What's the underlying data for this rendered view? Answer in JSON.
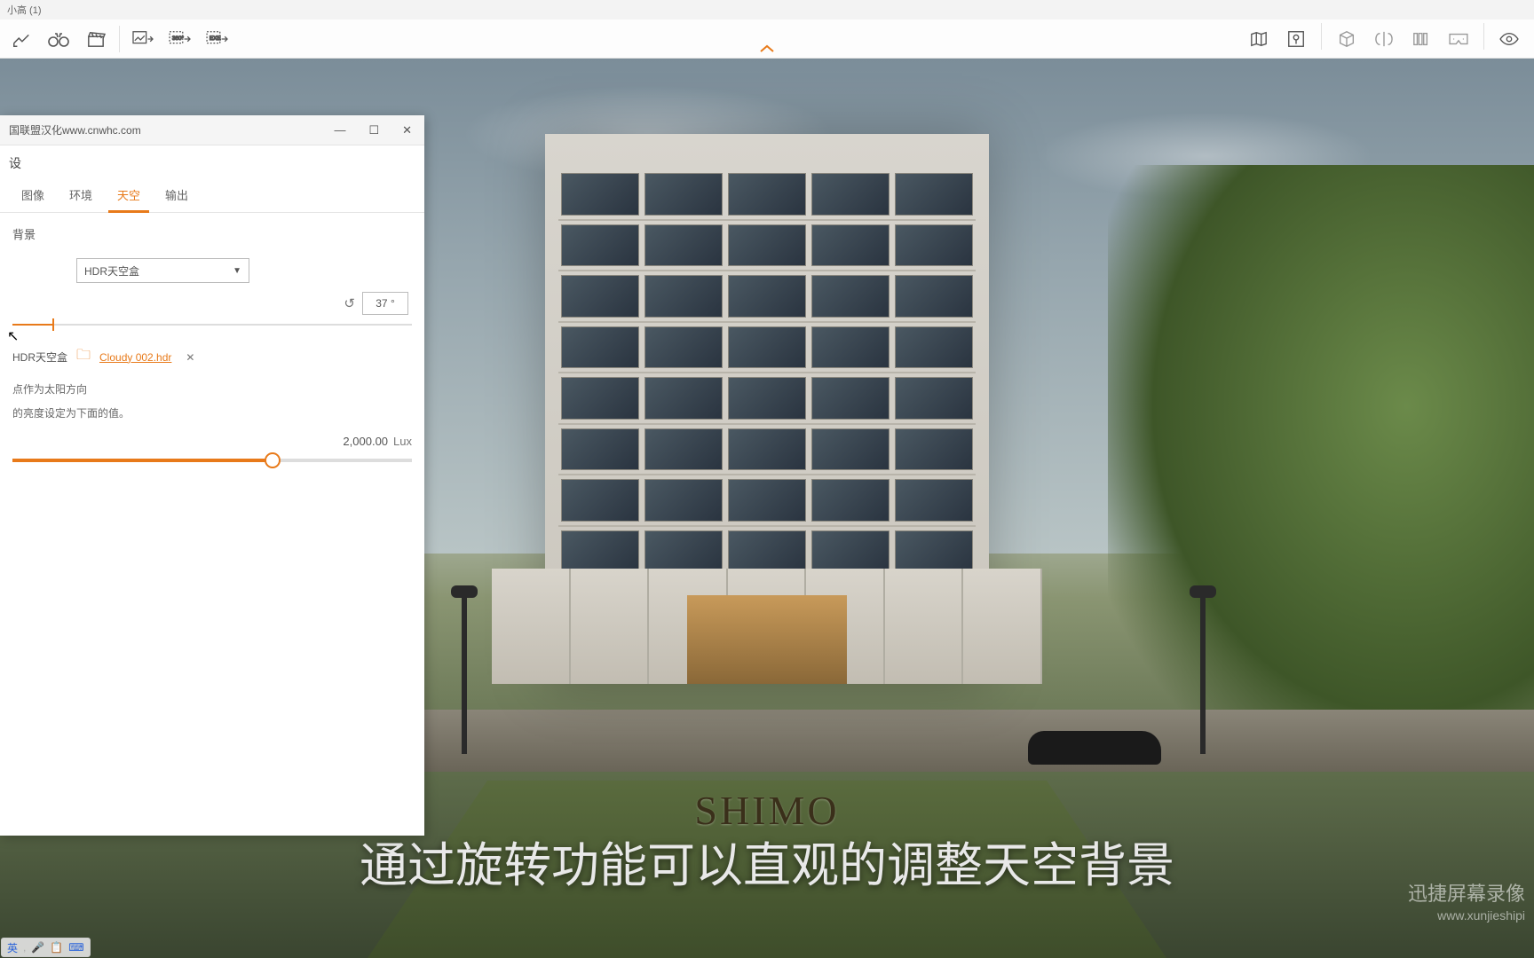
{
  "window": {
    "title": "小高 (1)"
  },
  "toolbar": {
    "center_arrow": "︿"
  },
  "panel": {
    "title": "国联盟汉化www.cnwhc.com",
    "header": "设",
    "tabs": [
      "图像",
      "环境",
      "天空",
      "输出"
    ],
    "active_tab_index": 2,
    "section_background": "背景",
    "skybox_select": "HDR天空盒",
    "rotation_value": "37",
    "rotation_unit": "°",
    "rotation_slider_percent": 10,
    "hdr_label": "HDR天空盒",
    "hdr_file": "Cloudy 002.hdr",
    "help1": "点作为太阳方向",
    "help2": "的亮度设定为下面的值。",
    "lux_value": "2,000.00",
    "lux_unit": "Lux",
    "lux_slider_percent": 65,
    "win_min": "—",
    "win_max": "☐",
    "win_close": "✕"
  },
  "scene": {
    "logo": "SHIMO"
  },
  "subtitle": "通过旋转功能可以直观的调整天空背景",
  "watermark": {
    "brand": "迅捷屏幕录像",
    "url": "www.xunjieshipi"
  },
  "ime": {
    "lang": "英",
    "items": [
      "🎤",
      "📋",
      "⌨"
    ]
  }
}
